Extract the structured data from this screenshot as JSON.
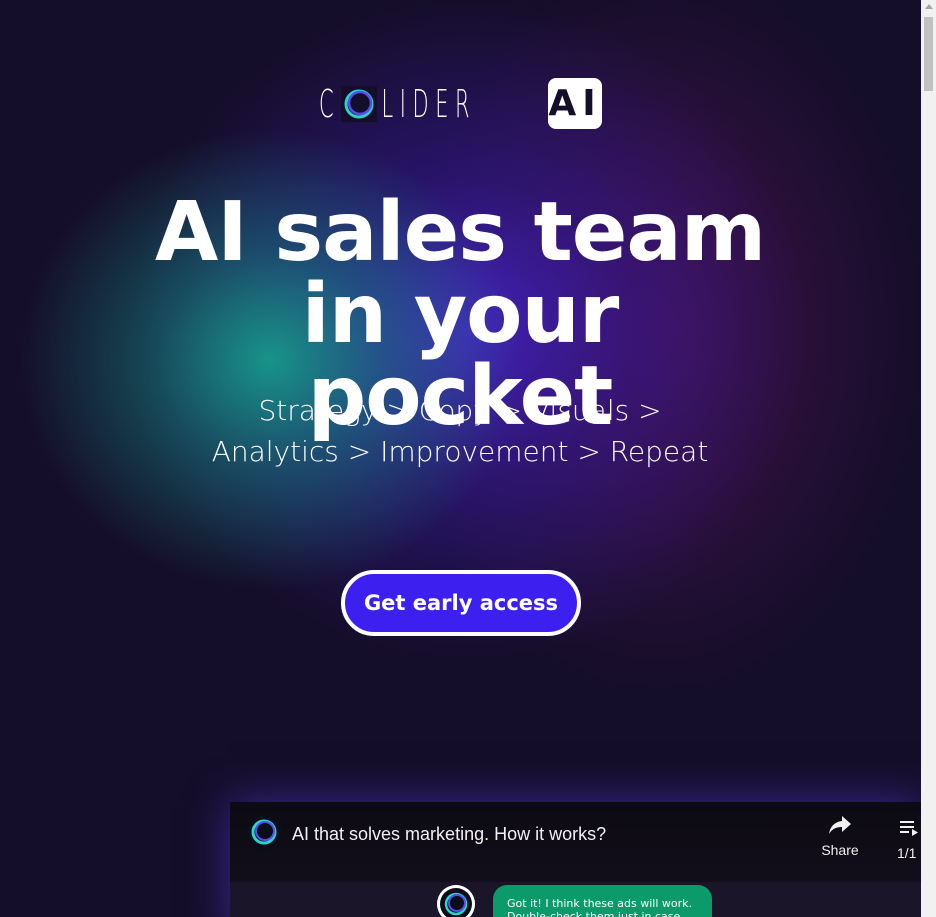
{
  "logo": {
    "word": "COLLIDER",
    "badge": "AI"
  },
  "hero": {
    "headline": "AI sales team in your pocket",
    "subtitle": "Strategy > Copy > Visuals > Analytics > Improvement > Repeat",
    "cta_label": "Get early access"
  },
  "video": {
    "title": "AI that solves marketing. How it works?",
    "share_label": "Share",
    "playlist_count": "1/1",
    "chat_text": "Got it! I think these ads will work. Double-check them just in case"
  },
  "colors": {
    "background": "#150e2a",
    "cta": "#3d1ff0",
    "accent_teal": "#16aa91",
    "accent_purple": "#4623c8",
    "chat_bubble": "#0c9a6a"
  }
}
